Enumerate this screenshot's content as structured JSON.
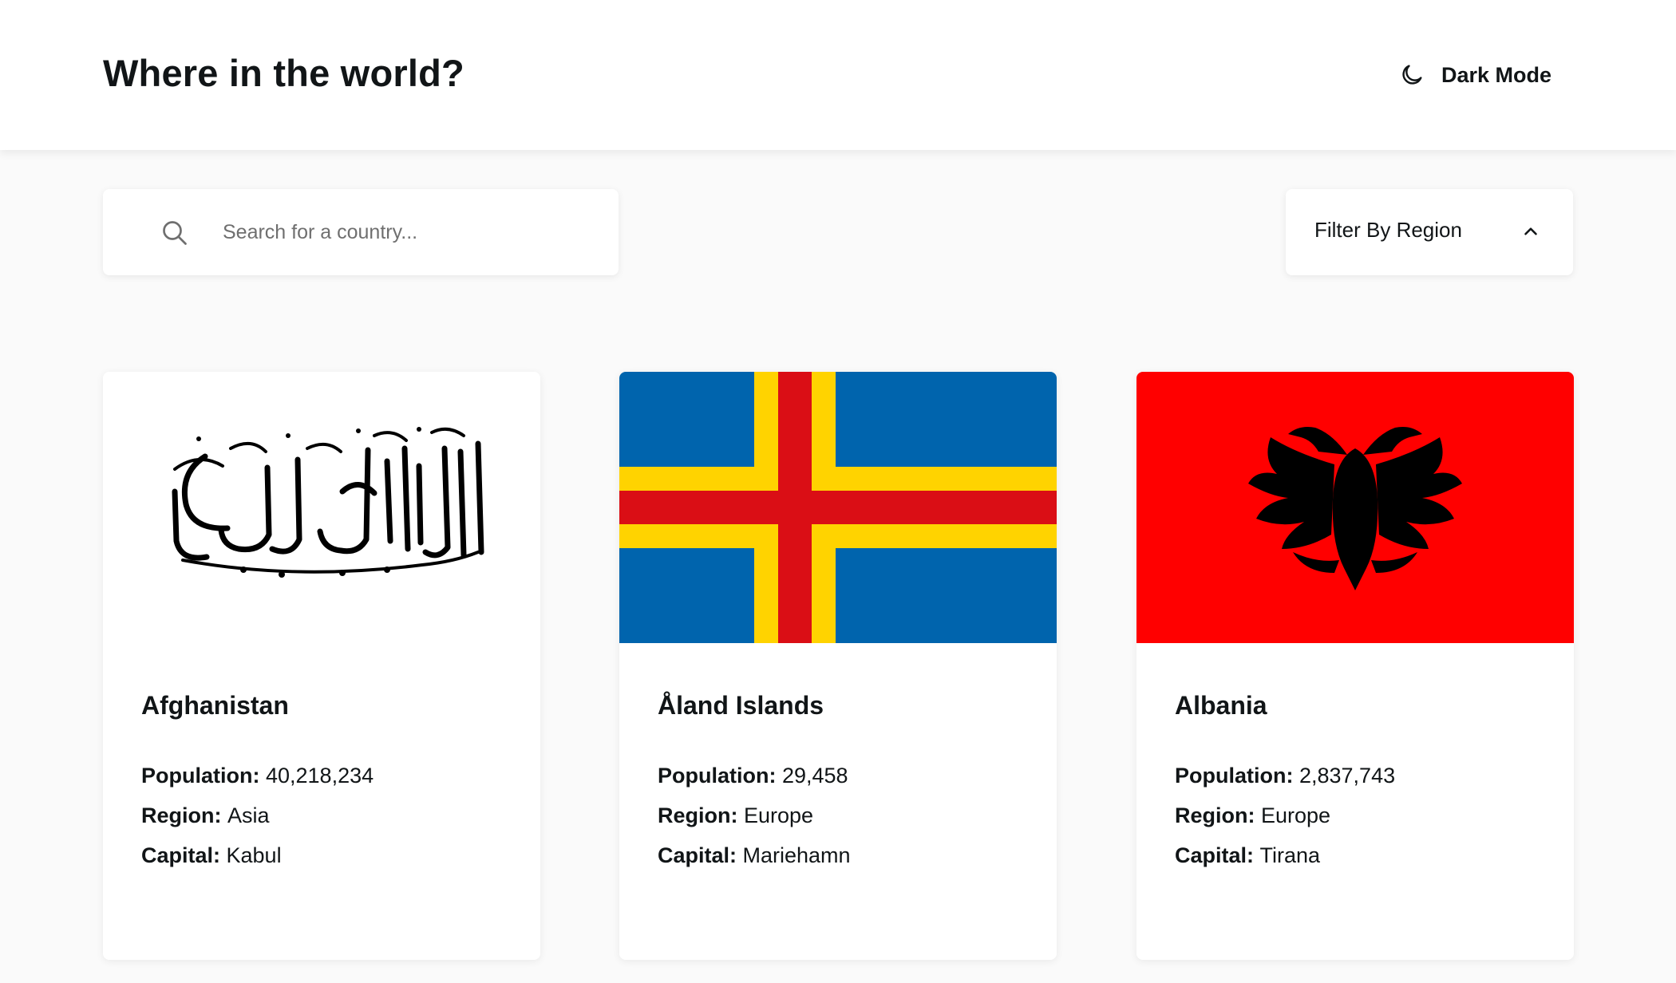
{
  "header": {
    "title": "Where in the world?",
    "theme_toggle": {
      "icon": "moon-icon",
      "label": "Dark Mode"
    }
  },
  "search": {
    "icon": "search-icon",
    "placeholder": "Search for a country...",
    "value": ""
  },
  "filter": {
    "label": "Filter By Region",
    "icon": "chevron-up-icon"
  },
  "labels": {
    "population": "Population:",
    "region": "Region:",
    "capital": "Capital:"
  },
  "countries": [
    {
      "name": "Afghanistan",
      "population": "40,218,234",
      "region": "Asia",
      "capital": "Kabul",
      "flag": "afghanistan-flag"
    },
    {
      "name": "Åland Islands",
      "population": "29,458",
      "region": "Europe",
      "capital": "Mariehamn",
      "flag": "aland-islands-flag"
    },
    {
      "name": "Albania",
      "population": "2,837,743",
      "region": "Europe",
      "capital": "Tirana",
      "flag": "albania-flag"
    }
  ],
  "colors": {
    "background": "#fafafa",
    "surface": "#ffffff",
    "text": "#111517",
    "aland_blue": "#0064AD",
    "aland_yellow": "#FFD300",
    "aland_red": "#DA0E15",
    "albania_red": "#FF0000"
  }
}
